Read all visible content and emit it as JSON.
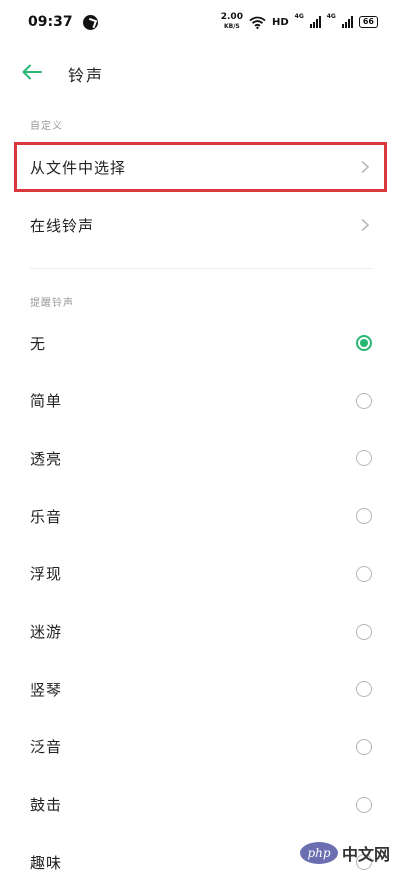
{
  "status_bar": {
    "time": "09:37",
    "speed_value": "2.00",
    "speed_unit": "KB/S",
    "hd_label": "HD",
    "sig1_tag": "4G",
    "sig2_tag": "4G",
    "battery": "66"
  },
  "header": {
    "title": "铃声"
  },
  "custom_section": {
    "label": "自定义",
    "items": [
      {
        "label": "从文件中选择",
        "highlighted": true
      },
      {
        "label": "在线铃声",
        "highlighted": false
      }
    ]
  },
  "system_section": {
    "label": "提醒铃声",
    "selected_index": 0,
    "items": [
      {
        "label": "无"
      },
      {
        "label": "简单"
      },
      {
        "label": "透亮"
      },
      {
        "label": "乐音"
      },
      {
        "label": "浮现"
      },
      {
        "label": "迷游"
      },
      {
        "label": "竖琴"
      },
      {
        "label": "泛音"
      },
      {
        "label": "鼓击"
      },
      {
        "label": "趣味"
      }
    ]
  },
  "watermark": {
    "logo_text": "php",
    "site_text": "中文网"
  },
  "colors": {
    "accent_green": "#28b872",
    "highlight_red": "#d9393c"
  }
}
